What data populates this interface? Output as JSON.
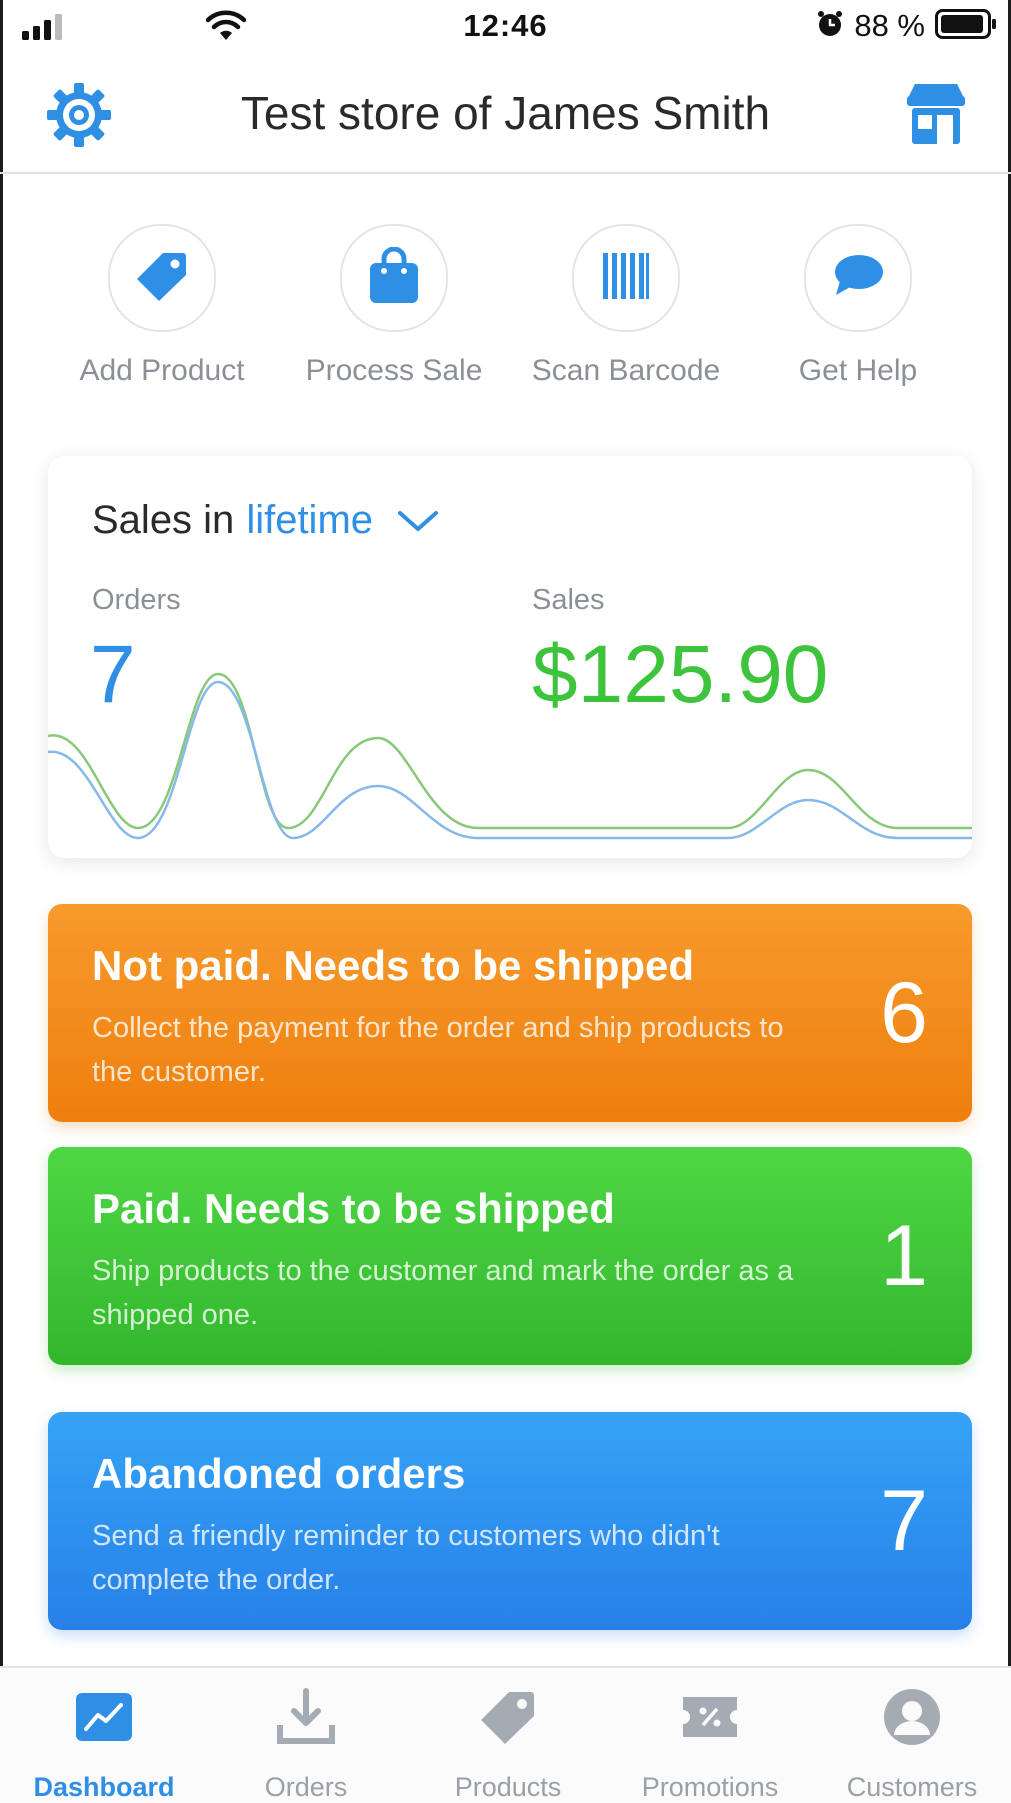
{
  "status_bar": {
    "time": "12:46",
    "battery_percent": "88 %"
  },
  "header": {
    "title": "Test store of James Smith"
  },
  "quick_actions": [
    {
      "label": "Add Product",
      "icon": "tag-icon"
    },
    {
      "label": "Process Sale",
      "icon": "shopping-bag-icon"
    },
    {
      "label": "Scan Barcode",
      "icon": "barcode-icon"
    },
    {
      "label": "Get Help",
      "icon": "chat-bubble-icon"
    }
  ],
  "sales_summary": {
    "title_prefix": "Sales in",
    "period": "lifetime",
    "orders_label": "Orders",
    "orders_value": "7",
    "sales_label": "Sales",
    "sales_value": "$125.90"
  },
  "status_cards": [
    {
      "title": "Not paid. Needs to be shipped",
      "description": "Collect the payment for the order and ship products to the customer.",
      "count": "6",
      "color": "#f08a1c"
    },
    {
      "title": "Paid. Needs to be shipped",
      "description": "Ship products to the customer and mark the order as a shipped one.",
      "count": "1",
      "color": "#3fc53a"
    },
    {
      "title": "Abandoned orders",
      "description": "Send a friendly reminder to customers who didn't complete the order.",
      "count": "7",
      "color": "#2e8ff0"
    }
  ],
  "tab_bar": {
    "tabs": [
      {
        "label": "Dashboard",
        "icon": "chart-icon",
        "active": true
      },
      {
        "label": "Orders",
        "icon": "download-icon",
        "active": false
      },
      {
        "label": "Products",
        "icon": "tag-icon",
        "active": false
      },
      {
        "label": "Promotions",
        "icon": "coupon-icon",
        "active": false
      },
      {
        "label": "Customers",
        "icon": "person-icon",
        "active": false
      }
    ]
  },
  "colors": {
    "accent": "#2f8fe5",
    "sales_green": "#3ec43c"
  }
}
